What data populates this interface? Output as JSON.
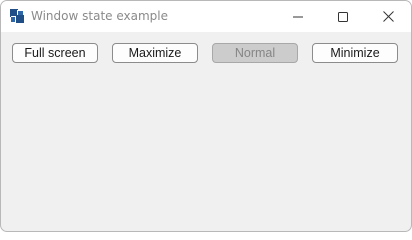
{
  "window": {
    "title": "Window state example",
    "caption_icons": {
      "minimize": "minimize-icon",
      "maximize": "maximize-icon",
      "close": "close-icon"
    }
  },
  "buttons": {
    "full_screen": "Full screen",
    "maximize": "Maximize",
    "normal": "Normal",
    "minimize": "Minimize"
  },
  "colors": {
    "app_icon": "#1f4f86",
    "disabled_button_bg": "#cccccc",
    "disabled_button_text": "#858585"
  }
}
